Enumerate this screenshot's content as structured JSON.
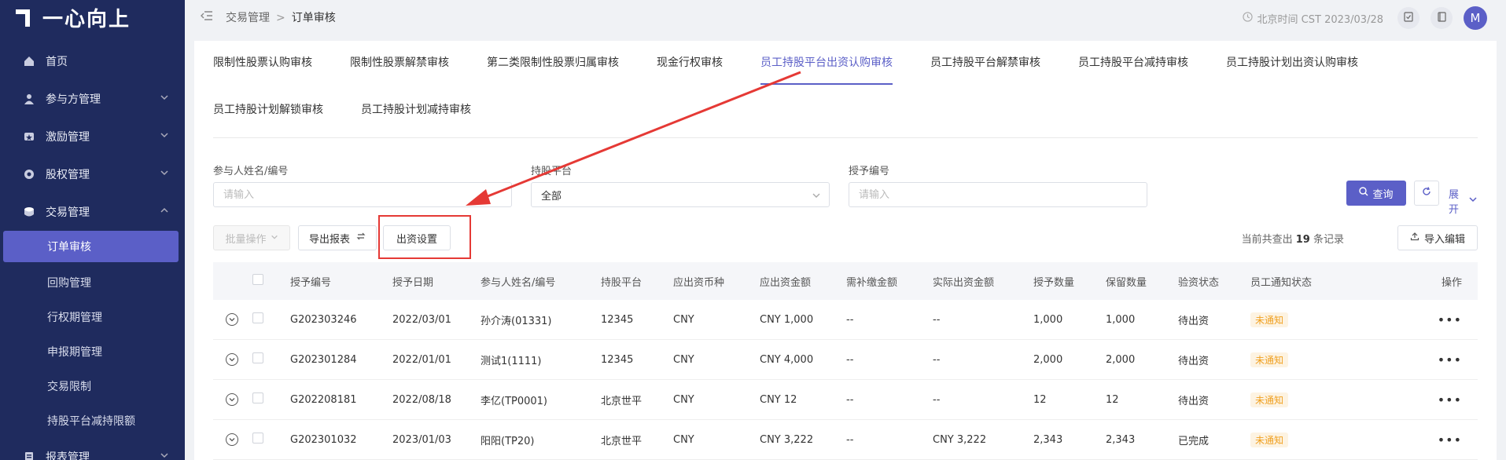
{
  "app": {
    "logo_text": "一心向上"
  },
  "sidebar": {
    "items": [
      {
        "label": "首页",
        "icon": "home-icon"
      },
      {
        "label": "参与方管理",
        "icon": "users-icon",
        "chevron": "down"
      },
      {
        "label": "激励管理",
        "icon": "award-icon",
        "chevron": "down"
      },
      {
        "label": "股权管理",
        "icon": "equity-icon",
        "chevron": "down"
      },
      {
        "label": "交易管理",
        "icon": "trade-icon",
        "chevron": "up"
      }
    ],
    "sub_items": [
      {
        "label": "订单审核",
        "active": true
      },
      {
        "label": "回购管理"
      },
      {
        "label": "行权期管理"
      },
      {
        "label": "申报期管理"
      },
      {
        "label": "交易限制"
      },
      {
        "label": "持股平台减持限额"
      }
    ],
    "bottom_item": {
      "label": "报表管理",
      "icon": "report-icon",
      "chevron": "down"
    }
  },
  "topbar": {
    "breadcrumb": [
      "交易管理",
      "订单审核"
    ],
    "time": "北京时间 CST 2023/03/28",
    "avatar": "M"
  },
  "tabs": {
    "row1": [
      "限制性股票认购审核",
      "限制性股票解禁审核",
      "第二类限制性股票归属审核",
      "现金行权审核",
      "员工持股平台出资认购审核",
      "员工持股平台解禁审核",
      "员工持股平台减持审核",
      "员工持股计划出资认购审核"
    ],
    "row2": [
      "员工持股计划解锁审核",
      "员工持股计划减持审核"
    ],
    "active": "员工持股平台出资认购审核"
  },
  "filters": {
    "participant": {
      "label": "参与人姓名/编号",
      "placeholder": "请输入"
    },
    "platform": {
      "label": "持股平台",
      "value": "全部"
    },
    "grant_no": {
      "label": "授予编号",
      "placeholder": "请输入"
    },
    "query_label": "查询",
    "expand_label": "展开"
  },
  "toolbar": {
    "batch_label": "批量操作",
    "export_label": "导出报表",
    "funding_label": "出资设置",
    "record_prefix": "当前共查出",
    "record_count": "19",
    "record_suffix": "条记录",
    "import_label": "导入编辑"
  },
  "table": {
    "headers": [
      "授予编号",
      "授予日期",
      "参与人姓名/编号",
      "持股平台",
      "应出资币种",
      "应出资金额",
      "需补缴金额",
      "实际出资金额",
      "授予数量",
      "保留数量",
      "验资状态",
      "员工通知状态",
      "操作"
    ],
    "rows": [
      {
        "no": "G202303246",
        "date": "2022/03/01",
        "name": "孙介涛(01331)",
        "platform": "12345",
        "currency": "CNY",
        "amount": "CNY 1,000",
        "supplement": "--",
        "actual": "--",
        "qty": "1,000",
        "reserved": "1,000",
        "verify": "待出资",
        "notice": "未通知"
      },
      {
        "no": "G202301284",
        "date": "2022/01/01",
        "name": "测试1(1111)",
        "platform": "12345",
        "currency": "CNY",
        "amount": "CNY 4,000",
        "supplement": "--",
        "actual": "--",
        "qty": "2,000",
        "reserved": "2,000",
        "verify": "待出资",
        "notice": "未通知"
      },
      {
        "no": "G202208181",
        "date": "2022/08/18",
        "name": "李亿(TP0001)",
        "platform": "北京世平",
        "currency": "CNY",
        "amount": "CNY 12",
        "supplement": "--",
        "actual": "--",
        "qty": "12",
        "reserved": "12",
        "verify": "待出资",
        "notice": "未通知"
      },
      {
        "no": "G202301032",
        "date": "2023/01/03",
        "name": "阳阳(TP20)",
        "platform": "北京世平",
        "currency": "CNY",
        "amount": "CNY 3,222",
        "supplement": "--",
        "actual": "CNY 3,222",
        "qty": "2,343",
        "reserved": "2,343",
        "verify": "已完成",
        "notice": "未通知"
      }
    ]
  },
  "colors": {
    "sidebar_bg": "#1f2b5e",
    "accent": "#5b5fc7",
    "annotation": "#e53935",
    "badge": "#f0a020"
  }
}
